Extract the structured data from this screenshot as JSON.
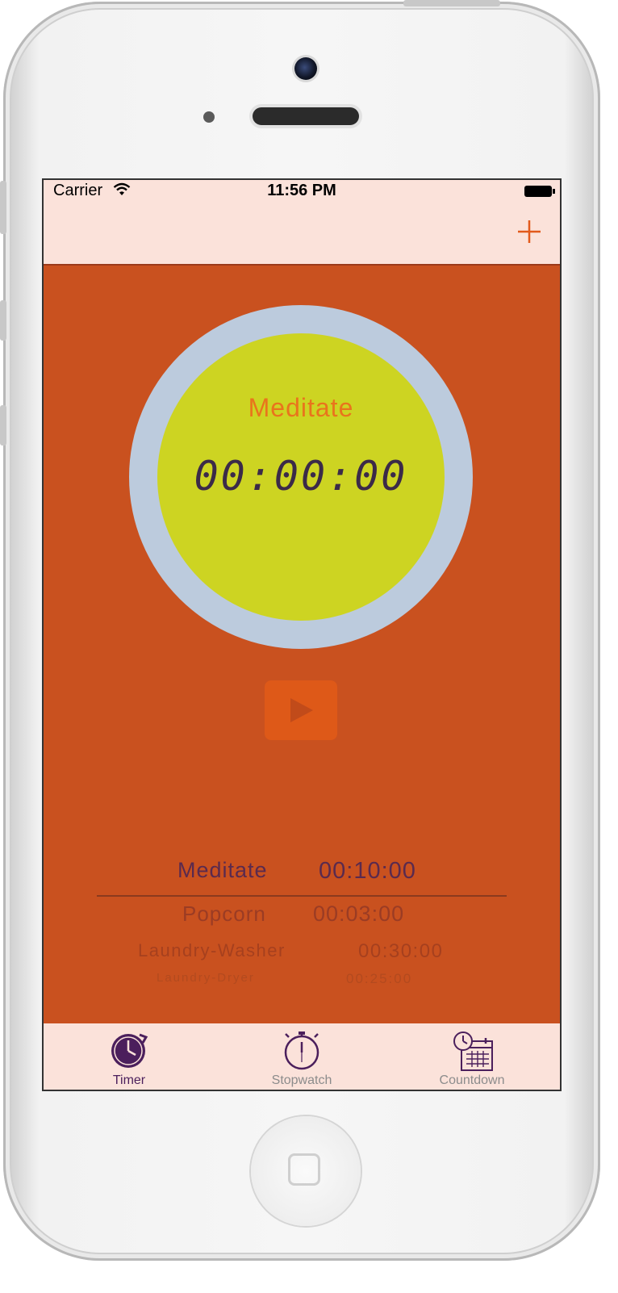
{
  "status_bar": {
    "carrier": "Carrier",
    "time": "11:56 PM"
  },
  "nav": {
    "add_icon": "plus-icon"
  },
  "timer_face": {
    "title": "Meditate",
    "display": "00:00:00"
  },
  "controls": {
    "play_icon": "play-icon"
  },
  "picker": {
    "items": [
      {
        "name": "Meditate",
        "time": "00:10:00"
      },
      {
        "name": "Popcorn",
        "time": "00:03:00"
      },
      {
        "name": "Laundry-Washer",
        "time": "00:30:00"
      },
      {
        "name": "Laundry-Dryer",
        "time": "00:25:00"
      }
    ]
  },
  "tabs": [
    {
      "label": "Timer",
      "icon": "clock-icon",
      "selected": true
    },
    {
      "label": "Stopwatch",
      "icon": "stopwatch-icon",
      "selected": false
    },
    {
      "label": "Countdown",
      "icon": "calendar-clock-icon",
      "selected": false
    }
  ],
  "colors": {
    "background": "#c9511f",
    "bars": "#fbe2da",
    "ring": "#bccbdd",
    "face": "#cdd422",
    "accent": "#e25a1c",
    "selected_tab": "#4b1f5c"
  }
}
